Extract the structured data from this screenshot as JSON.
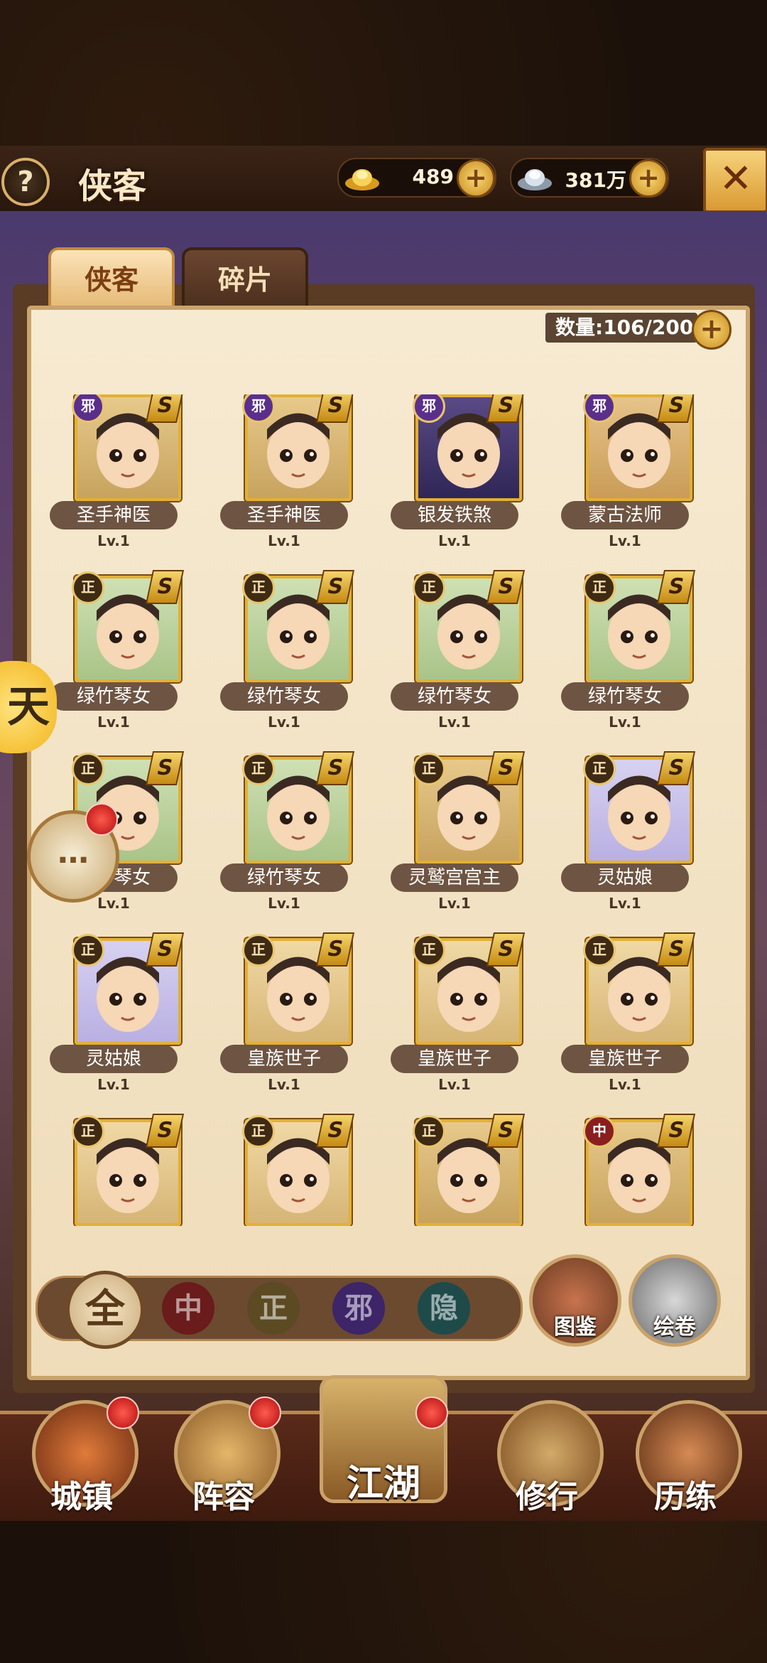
{
  "header": {
    "help_label": "?",
    "title": "侠客",
    "gold_value": "489",
    "silver_value": "381万",
    "plus_label": "+",
    "close_label": "✕"
  },
  "tabs": [
    {
      "label": "侠客",
      "active": true
    },
    {
      "label": "碎片",
      "active": false
    }
  ],
  "capacity": {
    "text": "数量:106/200",
    "plus_label": "+"
  },
  "heroes": [
    {
      "name": "圣手神医",
      "level": "Lv.1",
      "faction": "邪",
      "rank": "S",
      "palette": "old"
    },
    {
      "name": "圣手神医",
      "level": "Lv.1",
      "faction": "邪",
      "rank": "S",
      "palette": "old"
    },
    {
      "name": "银发铁煞",
      "level": "Lv.1",
      "faction": "邪",
      "rank": "S",
      "palette": "purple"
    },
    {
      "name": "蒙古法师",
      "level": "Lv.1",
      "faction": "邪",
      "rank": "S",
      "palette": "red"
    },
    {
      "name": "绿竹琴女",
      "level": "Lv.1",
      "faction": "正",
      "rank": "S",
      "palette": "green"
    },
    {
      "name": "绿竹琴女",
      "level": "Lv.1",
      "faction": "正",
      "rank": "S",
      "palette": "green"
    },
    {
      "name": "绿竹琴女",
      "level": "Lv.1",
      "faction": "正",
      "rank": "S",
      "palette": "green"
    },
    {
      "name": "绿竹琴女",
      "level": "Lv.1",
      "faction": "正",
      "rank": "S",
      "palette": "green"
    },
    {
      "name": "绿竹琴女",
      "level": "Lv.1",
      "faction": "正",
      "rank": "S",
      "palette": "green"
    },
    {
      "name": "绿竹琴女",
      "level": "Lv.1",
      "faction": "正",
      "rank": "S",
      "palette": "green"
    },
    {
      "name": "灵鹫宫宫主",
      "level": "Lv.1",
      "faction": "正",
      "rank": "S",
      "palette": "old"
    },
    {
      "name": "灵姑娘",
      "level": "Lv.1",
      "faction": "正",
      "rank": "S",
      "palette": "blue"
    },
    {
      "name": "灵姑娘",
      "level": "Lv.1",
      "faction": "正",
      "rank": "S",
      "palette": "blue"
    },
    {
      "name": "皇族世子",
      "level": "Lv.1",
      "faction": "正",
      "rank": "S",
      "palette": "tan"
    },
    {
      "name": "皇族世子",
      "level": "Lv.1",
      "faction": "正",
      "rank": "S",
      "palette": "tan"
    },
    {
      "name": "皇族世子",
      "level": "Lv.1",
      "faction": "正",
      "rank": "S",
      "palette": "tan"
    },
    {
      "name": "",
      "level": "",
      "faction": "正",
      "rank": "S",
      "palette": "tan"
    },
    {
      "name": "",
      "level": "",
      "faction": "正",
      "rank": "S",
      "palette": "tan"
    },
    {
      "name": "",
      "level": "",
      "faction": "正",
      "rank": "S",
      "palette": "old"
    },
    {
      "name": "",
      "level": "",
      "faction": "中",
      "rank": "S",
      "palette": "old"
    }
  ],
  "filters": [
    "全",
    "中",
    "正",
    "邪",
    "隐"
  ],
  "books": [
    "图鉴",
    "绘卷"
  ],
  "chat_icon": "…",
  "side_tab": "天",
  "nav": [
    {
      "label": "城镇",
      "badge": true
    },
    {
      "label": "阵容",
      "badge": true
    },
    {
      "label": "江湖",
      "badge": true
    },
    {
      "label": "修行",
      "badge": false
    },
    {
      "label": "历练",
      "badge": false
    }
  ],
  "colors": {
    "panel_bg": "#f6ead1",
    "accent_gold": "#e3b035",
    "faction_xie": "#5a2f8c",
    "faction_zhong": "#8a1e1e"
  }
}
